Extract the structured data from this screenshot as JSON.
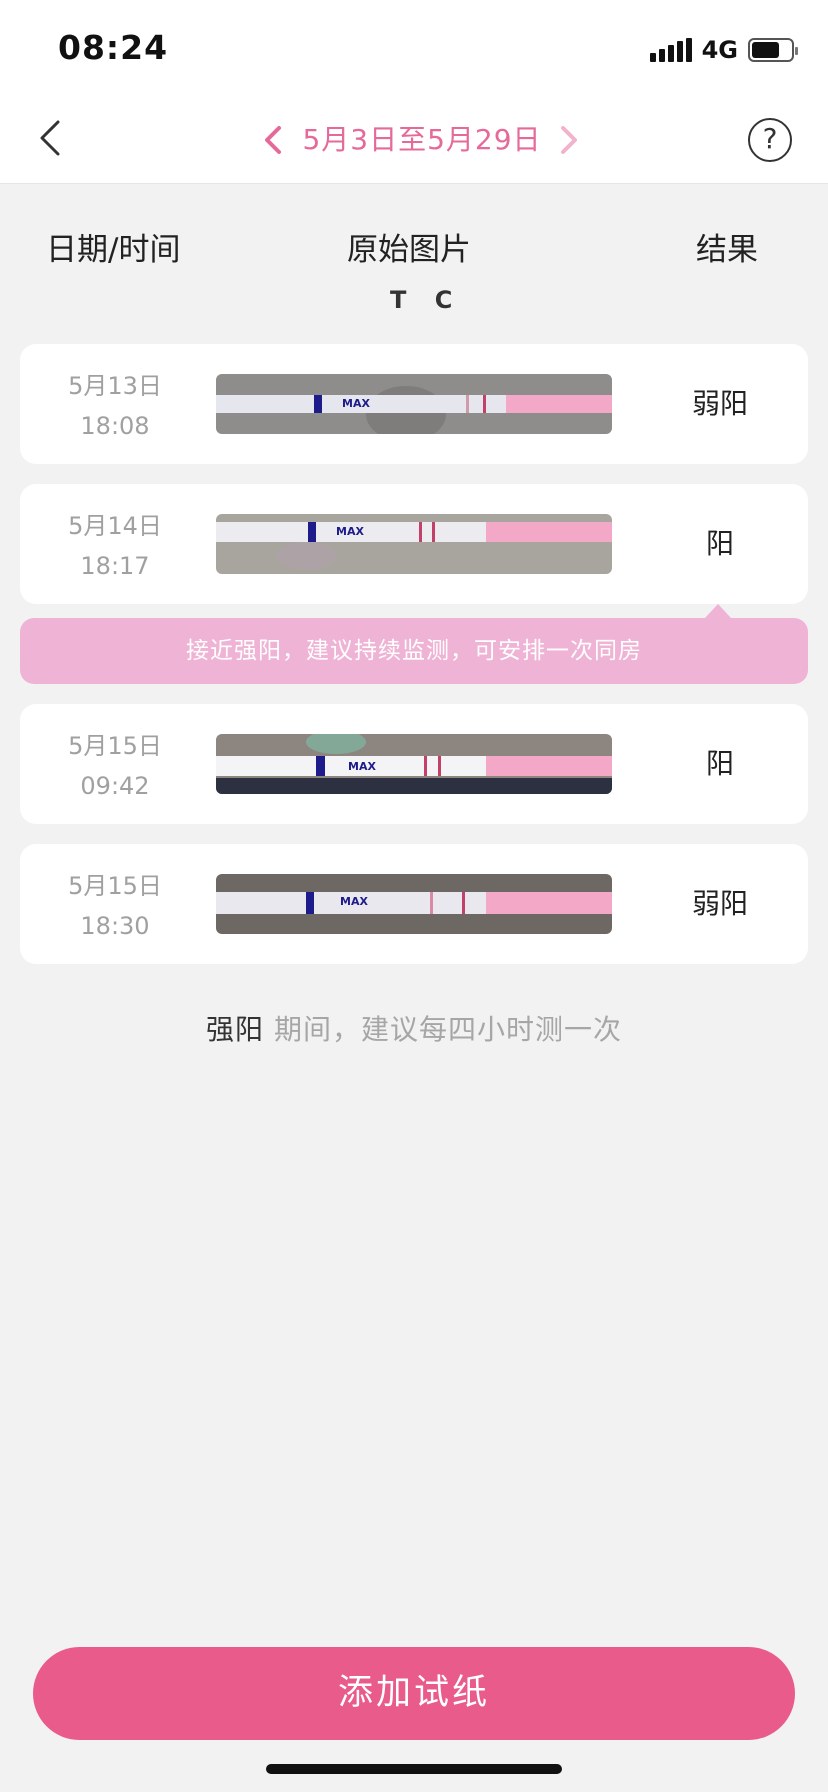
{
  "status_bar": {
    "time": "08:24",
    "network": "4G",
    "battery_level": 0.7
  },
  "nav": {
    "back_icon": "chevron-left-icon",
    "range_text": "5月3日至5月29日",
    "prev_icon": "chevron-left-icon",
    "next_icon": "chevron-right-icon",
    "help_label": "?",
    "accent_color": "#e56a9a"
  },
  "columns": {
    "date": "日期/时间",
    "image": "原始图片",
    "result": "结果",
    "tc": "T C"
  },
  "records": [
    {
      "date": "5月13日",
      "time": "18:08",
      "result": "弱阳"
    },
    {
      "date": "5月14日",
      "time": "18:17",
      "result": "阳"
    },
    {
      "date": "5月15日",
      "time": "09:42",
      "result": "阳"
    },
    {
      "date": "5月15日",
      "time": "18:30",
      "result": "弱阳"
    }
  ],
  "strip_text": {
    "max": "MAX"
  },
  "advice": {
    "text": "接近强阳，建议持续监测，可安排一次同房",
    "color": "#efb3d5"
  },
  "footer_tip": {
    "strong": "强阳",
    "rest": " 期间，建议每四小时测一次"
  },
  "add_button": {
    "label": "添加试纸",
    "color": "#e95b8a"
  }
}
